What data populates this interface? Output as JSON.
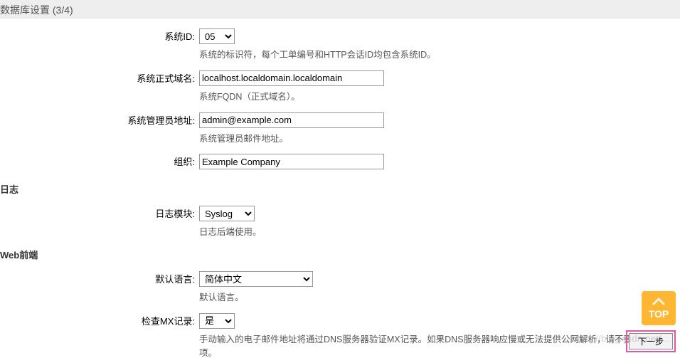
{
  "header": {
    "title": "数据库设置 (3/4)"
  },
  "system": {
    "id_label": "系统ID:",
    "id_value": "05",
    "id_help": "系统的标识符，每个工单编号和HTTP会话ID均包含系统ID。",
    "fqdn_label": "系统正式域名:",
    "fqdn_value": "localhost.localdomain.localdomain",
    "fqdn_help": "系统FQDN（正式域名）。",
    "admin_label": "系统管理员地址:",
    "admin_value": "admin@example.com",
    "admin_help": "系统管理员邮件地址。",
    "org_label": "组织:",
    "org_value": "Example Company"
  },
  "sections": {
    "log": "日志",
    "web": "Web前端"
  },
  "log": {
    "module_label": "日志模块:",
    "module_value": "Syslog",
    "module_help": "日志后端使用。"
  },
  "web": {
    "lang_label": "默认语言:",
    "lang_value": "简体中文",
    "lang_help": "默认语言。",
    "mx_label": "检查MX记录:",
    "mx_value": "是",
    "mx_help": "手动输入的电子邮件地址将通过DNS服务器验证MX记录。如果DNS服务器响应慢或无法提供公网解析，请不要使用此选项。"
  },
  "actions": {
    "top": "TOP",
    "next": "下一步"
  },
  "watermark": "https://blog.csdn.net/..."
}
